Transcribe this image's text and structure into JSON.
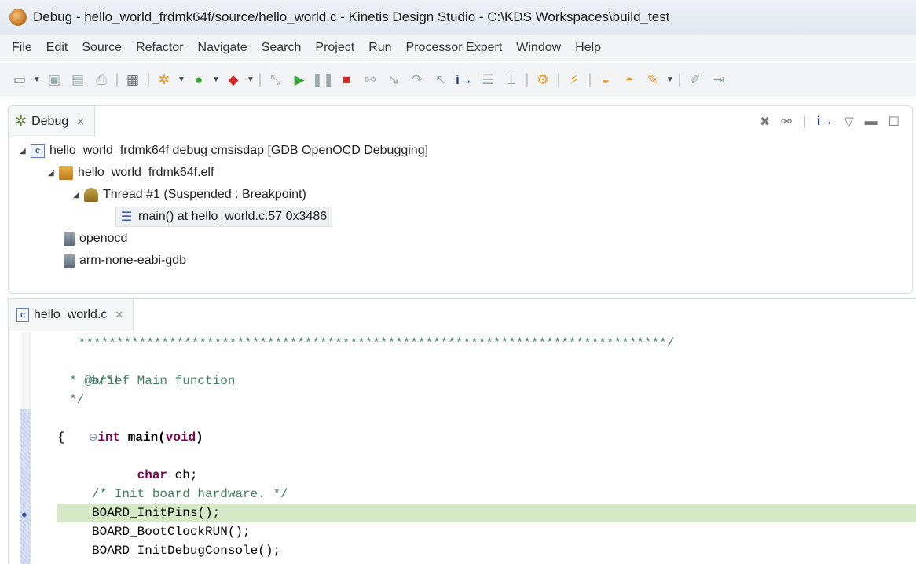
{
  "window": {
    "title": "Debug - hello_world_frdmk64f/source/hello_world.c - Kinetis Design Studio - C:\\KDS Workspaces\\build_test"
  },
  "menu": [
    "File",
    "Edit",
    "Source",
    "Refactor",
    "Navigate",
    "Search",
    "Project",
    "Run",
    "Processor Expert",
    "Window",
    "Help"
  ],
  "debug_view": {
    "tab_label": "Debug",
    "launch": "hello_world_frdmk64f debug cmsisdap [GDB OpenOCD Debugging]",
    "elf": "hello_world_frdmk64f.elf",
    "thread": "Thread #1 (Suspended : Breakpoint)",
    "frame": "main() at hello_world.c:57 0x3486",
    "process1": "openocd",
    "process2": "arm-none-eabi-gdb"
  },
  "editor": {
    "tab_label": "hello_world.c",
    "lines": {
      "l0": "   ******************************************************************************/",
      "l1_fold": "⊖",
      "l1": "/*!",
      "l2": "  * @brief Main function",
      "l3": "  */",
      "l4_fold": "⊖",
      "l4_kw": "int",
      "l4_fn": " main(",
      "l4_kw2": "void",
      "l4_end": ")",
      "l5": "{",
      "l6_kw": "char",
      "l6_rest": " ch;",
      "l7": "",
      "l8": "/* Init board hardware. */",
      "l9": "BOARD_InitPins();",
      "l10": "BOARD_BootClockRUN();",
      "l11": "BOARD_InitDebugConsole();"
    }
  },
  "colors": {
    "comment": "#3f7f5f",
    "keyword": "#7f0055",
    "current_line": "#d6e9c6"
  }
}
